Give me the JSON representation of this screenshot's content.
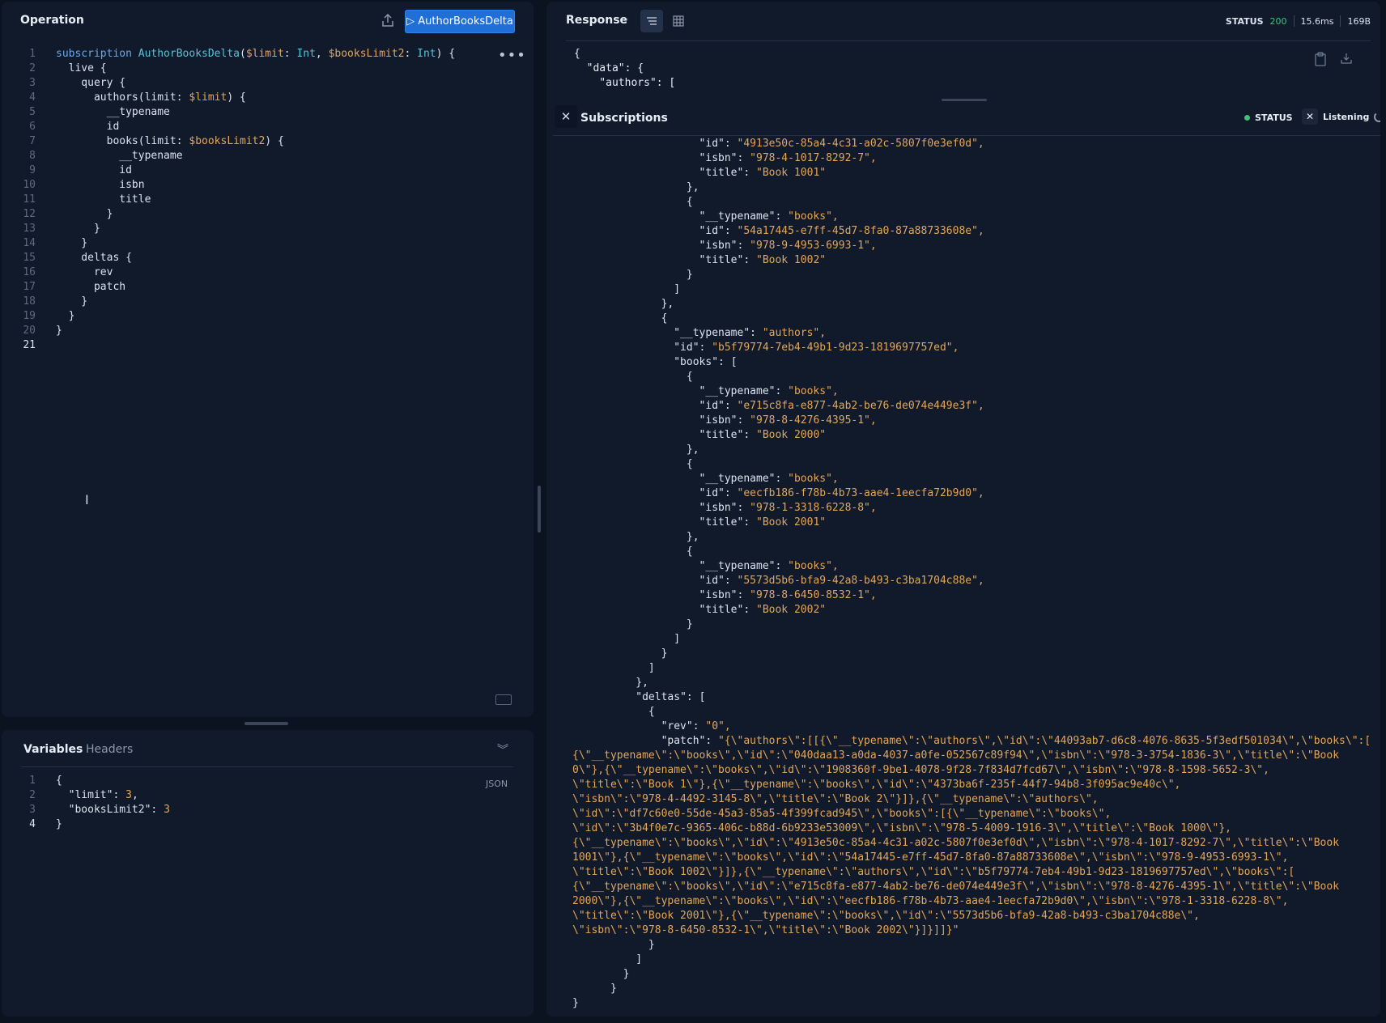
{
  "operation": {
    "title": "Operation",
    "run_button": "▷ AuthorBooksDelta",
    "more": "•••",
    "code_lines": [
      [
        {
          "t": "subscription ",
          "c": "kw"
        },
        {
          "t": "AuthorBooksDelta",
          "c": "nm"
        },
        {
          "t": "(",
          "c": "fld"
        },
        {
          "t": "$limit",
          "c": "var"
        },
        {
          "t": ": ",
          "c": "fld"
        },
        {
          "t": "Int",
          "c": "tp"
        },
        {
          "t": ", ",
          "c": "fld"
        },
        {
          "t": "$booksLimit2",
          "c": "var"
        },
        {
          "t": ": ",
          "c": "fld"
        },
        {
          "t": "Int",
          "c": "tp"
        },
        {
          "t": ") {",
          "c": "fld"
        }
      ],
      [
        {
          "t": "  live {",
          "c": "fld"
        }
      ],
      [
        {
          "t": "    query {",
          "c": "fld"
        }
      ],
      [
        {
          "t": "      authors(limit: ",
          "c": "fld"
        },
        {
          "t": "$limit",
          "c": "var"
        },
        {
          "t": ") {",
          "c": "fld"
        }
      ],
      [
        {
          "t": "        __typename",
          "c": "fld"
        }
      ],
      [
        {
          "t": "        id",
          "c": "fld"
        }
      ],
      [
        {
          "t": "        books(limit: ",
          "c": "fld"
        },
        {
          "t": "$booksLimit2",
          "c": "var"
        },
        {
          "t": ") {",
          "c": "fld"
        }
      ],
      [
        {
          "t": "          __typename",
          "c": "fld"
        }
      ],
      [
        {
          "t": "          id",
          "c": "fld"
        }
      ],
      [
        {
          "t": "          isbn",
          "c": "fld"
        }
      ],
      [
        {
          "t": "          title",
          "c": "fld"
        }
      ],
      [
        {
          "t": "        }",
          "c": "fld"
        }
      ],
      [
        {
          "t": "      }",
          "c": "fld"
        }
      ],
      [
        {
          "t": "    }",
          "c": "fld"
        }
      ],
      [
        {
          "t": "    deltas {",
          "c": "fld"
        }
      ],
      [
        {
          "t": "      rev",
          "c": "fld"
        }
      ],
      [
        {
          "t": "      patch",
          "c": "fld"
        }
      ],
      [
        {
          "t": "    }",
          "c": "fld"
        }
      ],
      [
        {
          "t": "  }",
          "c": "fld"
        }
      ],
      [
        {
          "t": "}",
          "c": "fld"
        }
      ],
      [
        {
          "t": "",
          "c": "fld"
        }
      ]
    ]
  },
  "variables": {
    "tab_variables": "Variables",
    "tab_headers": "Headers",
    "badge": "JSON",
    "code_lines": [
      [
        {
          "t": "{",
          "c": "fld"
        }
      ],
      [
        {
          "t": "  \"limit\"",
          "c": "key"
        },
        {
          "t": ": ",
          "c": "fld"
        },
        {
          "t": "3",
          "c": "num"
        },
        {
          "t": ",",
          "c": "fld"
        }
      ],
      [
        {
          "t": "  \"booksLimit2\"",
          "c": "key"
        },
        {
          "t": ": ",
          "c": "fld"
        },
        {
          "t": "3",
          "c": "num"
        }
      ],
      [
        {
          "t": "}",
          "c": "fld"
        }
      ]
    ]
  },
  "response": {
    "title": "Response",
    "status_label": "STATUS",
    "status_code": "200",
    "time": "15.6ms",
    "size": "169B",
    "preview_lines": [
      "{",
      "  \"data\": {",
      "    \"authors\": ["
    ]
  },
  "subscriptions": {
    "title": "Subscriptions",
    "status_label": "STATUS",
    "listening_label": "Listening",
    "lines": [
      {
        "i": 10,
        "k": "\"id\"",
        "v": "\"4913e50c-85a4-4c31-a02c-5807f0e3ef0d\","
      },
      {
        "i": 10,
        "k": "\"isbn\"",
        "v": "\"978-4-1017-8292-7\","
      },
      {
        "i": 10,
        "k": "\"title\"",
        "v": "\"Book 1001\""
      },
      {
        "i": 9,
        "p": "},"
      },
      {
        "i": 9,
        "p": "{"
      },
      {
        "i": 10,
        "k": "\"__typename\"",
        "v": "\"books\","
      },
      {
        "i": 10,
        "k": "\"id\"",
        "v": "\"54a17445-e7ff-45d7-8fa0-87a88733608e\","
      },
      {
        "i": 10,
        "k": "\"isbn\"",
        "v": "\"978-9-4953-6993-1\","
      },
      {
        "i": 10,
        "k": "\"title\"",
        "v": "\"Book 1002\""
      },
      {
        "i": 9,
        "p": "}"
      },
      {
        "i": 8,
        "p": "]"
      },
      {
        "i": 7,
        "p": "},"
      },
      {
        "i": 7,
        "p": "{"
      },
      {
        "i": 8,
        "k": "\"__typename\"",
        "v": "\"authors\","
      },
      {
        "i": 8,
        "k": "\"id\"",
        "v": "\"b5f79774-7eb4-49b1-9d23-1819697757ed\","
      },
      {
        "i": 8,
        "k": "\"books\"",
        "v": "[",
        "vp": true
      },
      {
        "i": 9,
        "p": "{"
      },
      {
        "i": 10,
        "k": "\"__typename\"",
        "v": "\"books\","
      },
      {
        "i": 10,
        "k": "\"id\"",
        "v": "\"e715c8fa-e877-4ab2-be76-de074e449e3f\","
      },
      {
        "i": 10,
        "k": "\"isbn\"",
        "v": "\"978-8-4276-4395-1\","
      },
      {
        "i": 10,
        "k": "\"title\"",
        "v": "\"Book 2000\""
      },
      {
        "i": 9,
        "p": "},"
      },
      {
        "i": 9,
        "p": "{"
      },
      {
        "i": 10,
        "k": "\"__typename\"",
        "v": "\"books\","
      },
      {
        "i": 10,
        "k": "\"id\"",
        "v": "\"eecfb186-f78b-4b73-aae4-1eecfa72b9d0\","
      },
      {
        "i": 10,
        "k": "\"isbn\"",
        "v": "\"978-1-3318-6228-8\","
      },
      {
        "i": 10,
        "k": "\"title\"",
        "v": "\"Book 2001\""
      },
      {
        "i": 9,
        "p": "},"
      },
      {
        "i": 9,
        "p": "{"
      },
      {
        "i": 10,
        "k": "\"__typename\"",
        "v": "\"books\","
      },
      {
        "i": 10,
        "k": "\"id\"",
        "v": "\"5573d5b6-bfa9-42a8-b493-c3ba1704c88e\","
      },
      {
        "i": 10,
        "k": "\"isbn\"",
        "v": "\"978-8-6450-8532-1\","
      },
      {
        "i": 10,
        "k": "\"title\"",
        "v": "\"Book 2002\""
      },
      {
        "i": 9,
        "p": "}"
      },
      {
        "i": 8,
        "p": "]"
      },
      {
        "i": 7,
        "p": "}"
      },
      {
        "i": 6,
        "p": "]"
      },
      {
        "i": 5,
        "p": "},"
      },
      {
        "i": 5,
        "k": "\"deltas\"",
        "v": "[",
        "vp": true
      },
      {
        "i": 6,
        "p": "{"
      },
      {
        "i": 7,
        "k": "\"rev\"",
        "v": "\"0\","
      },
      {
        "i": 7,
        "k": "\"patch\"",
        "v": "\"{\\\"authors\\\":[[{\\\"__typename\\\":\\\"authors\\\",\\\"id\\\":\\\"44093ab7-d6c8-4076-8635-5f3edf501034\\\",\\\"books\\\":["
      }
    ],
    "patch_continuation": [
      "{\\\"__typename\\\":\\\"books\\\",\\\"id\\\":\\\"040daa13-a0da-4037-a0fe-052567c89f94\\\",\\\"isbn\\\":\\\"978-3-3754-1836-3\\\",\\\"title\\\":\\\"Book",
      "0\\\"},{\\\"__typename\\\":\\\"books\\\",\\\"id\\\":\\\"1908360f-9be1-4078-9f28-7f834d7fcd67\\\",\\\"isbn\\\":\\\"978-8-1598-5652-3\\\",",
      "\\\"title\\\":\\\"Book 1\\\"},{\\\"__typename\\\":\\\"books\\\",\\\"id\\\":\\\"4373ba6f-235f-44f7-94b8-3f095ac9e40c\\\",",
      "\\\"isbn\\\":\\\"978-4-4492-3145-8\\\",\\\"title\\\":\\\"Book 2\\\"}]},{\\\"__typename\\\":\\\"authors\\\",",
      "\\\"id\\\":\\\"df7c60e0-55de-45a3-85a5-4f399fcad945\\\",\\\"books\\\":[{\\\"__typename\\\":\\\"books\\\",",
      "\\\"id\\\":\\\"3b4f0e7c-9365-406c-b88d-6b9233e53009\\\",\\\"isbn\\\":\\\"978-5-4009-1916-3\\\",\\\"title\\\":\\\"Book 1000\\\"},",
      "{\\\"__typename\\\":\\\"books\\\",\\\"id\\\":\\\"4913e50c-85a4-4c31-a02c-5807f0e3ef0d\\\",\\\"isbn\\\":\\\"978-4-1017-8292-7\\\",\\\"title\\\":\\\"Book",
      "1001\\\"},{\\\"__typename\\\":\\\"books\\\",\\\"id\\\":\\\"54a17445-e7ff-45d7-8fa0-87a88733608e\\\",\\\"isbn\\\":\\\"978-9-4953-6993-1\\\",",
      "\\\"title\\\":\\\"Book 1002\\\"}]},{\\\"__typename\\\":\\\"authors\\\",\\\"id\\\":\\\"b5f79774-7eb4-49b1-9d23-1819697757ed\\\",\\\"books\\\":[",
      "{\\\"__typename\\\":\\\"books\\\",\\\"id\\\":\\\"e715c8fa-e877-4ab2-be76-de074e449e3f\\\",\\\"isbn\\\":\\\"978-8-4276-4395-1\\\",\\\"title\\\":\\\"Book",
      "2000\\\"},{\\\"__typename\\\":\\\"books\\\",\\\"id\\\":\\\"eecfb186-f78b-4b73-aae4-1eecfa72b9d0\\\",\\\"isbn\\\":\\\"978-1-3318-6228-8\\\",",
      "\\\"title\\\":\\\"Book 2001\\\"},{\\\"__typename\\\":\\\"books\\\",\\\"id\\\":\\\"5573d5b6-bfa9-42a8-b493-c3ba1704c88e\\\",",
      "\\\"isbn\\\":\\\"978-8-6450-8532-1\\\",\\\"title\\\":\\\"Book 2002\\\"}]}]]}\""
    ],
    "closing_lines": [
      {
        "i": 6,
        "p": "}"
      },
      {
        "i": 5,
        "p": "]"
      },
      {
        "i": 4,
        "p": "}"
      },
      {
        "i": 3,
        "p": "}"
      },
      {
        "i": 0,
        "p": "}"
      }
    ]
  }
}
